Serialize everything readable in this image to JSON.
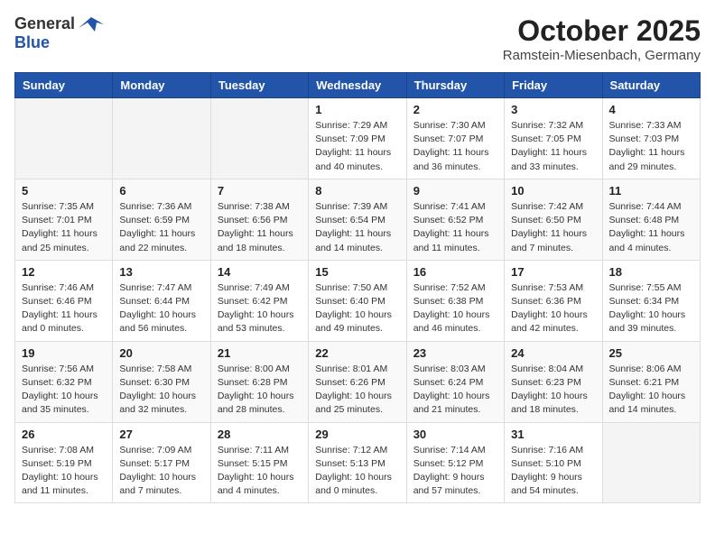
{
  "header": {
    "logo_general": "General",
    "logo_blue": "Blue",
    "month_title": "October 2025",
    "location": "Ramstein-Miesenbach, Germany"
  },
  "weekdays": [
    "Sunday",
    "Monday",
    "Tuesday",
    "Wednesday",
    "Thursday",
    "Friday",
    "Saturday"
  ],
  "weeks": [
    [
      {
        "day": "",
        "info": ""
      },
      {
        "day": "",
        "info": ""
      },
      {
        "day": "",
        "info": ""
      },
      {
        "day": "1",
        "info": "Sunrise: 7:29 AM\nSunset: 7:09 PM\nDaylight: 11 hours\nand 40 minutes."
      },
      {
        "day": "2",
        "info": "Sunrise: 7:30 AM\nSunset: 7:07 PM\nDaylight: 11 hours\nand 36 minutes."
      },
      {
        "day": "3",
        "info": "Sunrise: 7:32 AM\nSunset: 7:05 PM\nDaylight: 11 hours\nand 33 minutes."
      },
      {
        "day": "4",
        "info": "Sunrise: 7:33 AM\nSunset: 7:03 PM\nDaylight: 11 hours\nand 29 minutes."
      }
    ],
    [
      {
        "day": "5",
        "info": "Sunrise: 7:35 AM\nSunset: 7:01 PM\nDaylight: 11 hours\nand 25 minutes."
      },
      {
        "day": "6",
        "info": "Sunrise: 7:36 AM\nSunset: 6:59 PM\nDaylight: 11 hours\nand 22 minutes."
      },
      {
        "day": "7",
        "info": "Sunrise: 7:38 AM\nSunset: 6:56 PM\nDaylight: 11 hours\nand 18 minutes."
      },
      {
        "day": "8",
        "info": "Sunrise: 7:39 AM\nSunset: 6:54 PM\nDaylight: 11 hours\nand 14 minutes."
      },
      {
        "day": "9",
        "info": "Sunrise: 7:41 AM\nSunset: 6:52 PM\nDaylight: 11 hours\nand 11 minutes."
      },
      {
        "day": "10",
        "info": "Sunrise: 7:42 AM\nSunset: 6:50 PM\nDaylight: 11 hours\nand 7 minutes."
      },
      {
        "day": "11",
        "info": "Sunrise: 7:44 AM\nSunset: 6:48 PM\nDaylight: 11 hours\nand 4 minutes."
      }
    ],
    [
      {
        "day": "12",
        "info": "Sunrise: 7:46 AM\nSunset: 6:46 PM\nDaylight: 11 hours\nand 0 minutes."
      },
      {
        "day": "13",
        "info": "Sunrise: 7:47 AM\nSunset: 6:44 PM\nDaylight: 10 hours\nand 56 minutes."
      },
      {
        "day": "14",
        "info": "Sunrise: 7:49 AM\nSunset: 6:42 PM\nDaylight: 10 hours\nand 53 minutes."
      },
      {
        "day": "15",
        "info": "Sunrise: 7:50 AM\nSunset: 6:40 PM\nDaylight: 10 hours\nand 49 minutes."
      },
      {
        "day": "16",
        "info": "Sunrise: 7:52 AM\nSunset: 6:38 PM\nDaylight: 10 hours\nand 46 minutes."
      },
      {
        "day": "17",
        "info": "Sunrise: 7:53 AM\nSunset: 6:36 PM\nDaylight: 10 hours\nand 42 minutes."
      },
      {
        "day": "18",
        "info": "Sunrise: 7:55 AM\nSunset: 6:34 PM\nDaylight: 10 hours\nand 39 minutes."
      }
    ],
    [
      {
        "day": "19",
        "info": "Sunrise: 7:56 AM\nSunset: 6:32 PM\nDaylight: 10 hours\nand 35 minutes."
      },
      {
        "day": "20",
        "info": "Sunrise: 7:58 AM\nSunset: 6:30 PM\nDaylight: 10 hours\nand 32 minutes."
      },
      {
        "day": "21",
        "info": "Sunrise: 8:00 AM\nSunset: 6:28 PM\nDaylight: 10 hours\nand 28 minutes."
      },
      {
        "day": "22",
        "info": "Sunrise: 8:01 AM\nSunset: 6:26 PM\nDaylight: 10 hours\nand 25 minutes."
      },
      {
        "day": "23",
        "info": "Sunrise: 8:03 AM\nSunset: 6:24 PM\nDaylight: 10 hours\nand 21 minutes."
      },
      {
        "day": "24",
        "info": "Sunrise: 8:04 AM\nSunset: 6:23 PM\nDaylight: 10 hours\nand 18 minutes."
      },
      {
        "day": "25",
        "info": "Sunrise: 8:06 AM\nSunset: 6:21 PM\nDaylight: 10 hours\nand 14 minutes."
      }
    ],
    [
      {
        "day": "26",
        "info": "Sunrise: 7:08 AM\nSunset: 5:19 PM\nDaylight: 10 hours\nand 11 minutes."
      },
      {
        "day": "27",
        "info": "Sunrise: 7:09 AM\nSunset: 5:17 PM\nDaylight: 10 hours\nand 7 minutes."
      },
      {
        "day": "28",
        "info": "Sunrise: 7:11 AM\nSunset: 5:15 PM\nDaylight: 10 hours\nand 4 minutes."
      },
      {
        "day": "29",
        "info": "Sunrise: 7:12 AM\nSunset: 5:13 PM\nDaylight: 10 hours\nand 0 minutes."
      },
      {
        "day": "30",
        "info": "Sunrise: 7:14 AM\nSunset: 5:12 PM\nDaylight: 9 hours\nand 57 minutes."
      },
      {
        "day": "31",
        "info": "Sunrise: 7:16 AM\nSunset: 5:10 PM\nDaylight: 9 hours\nand 54 minutes."
      },
      {
        "day": "",
        "info": ""
      }
    ]
  ]
}
